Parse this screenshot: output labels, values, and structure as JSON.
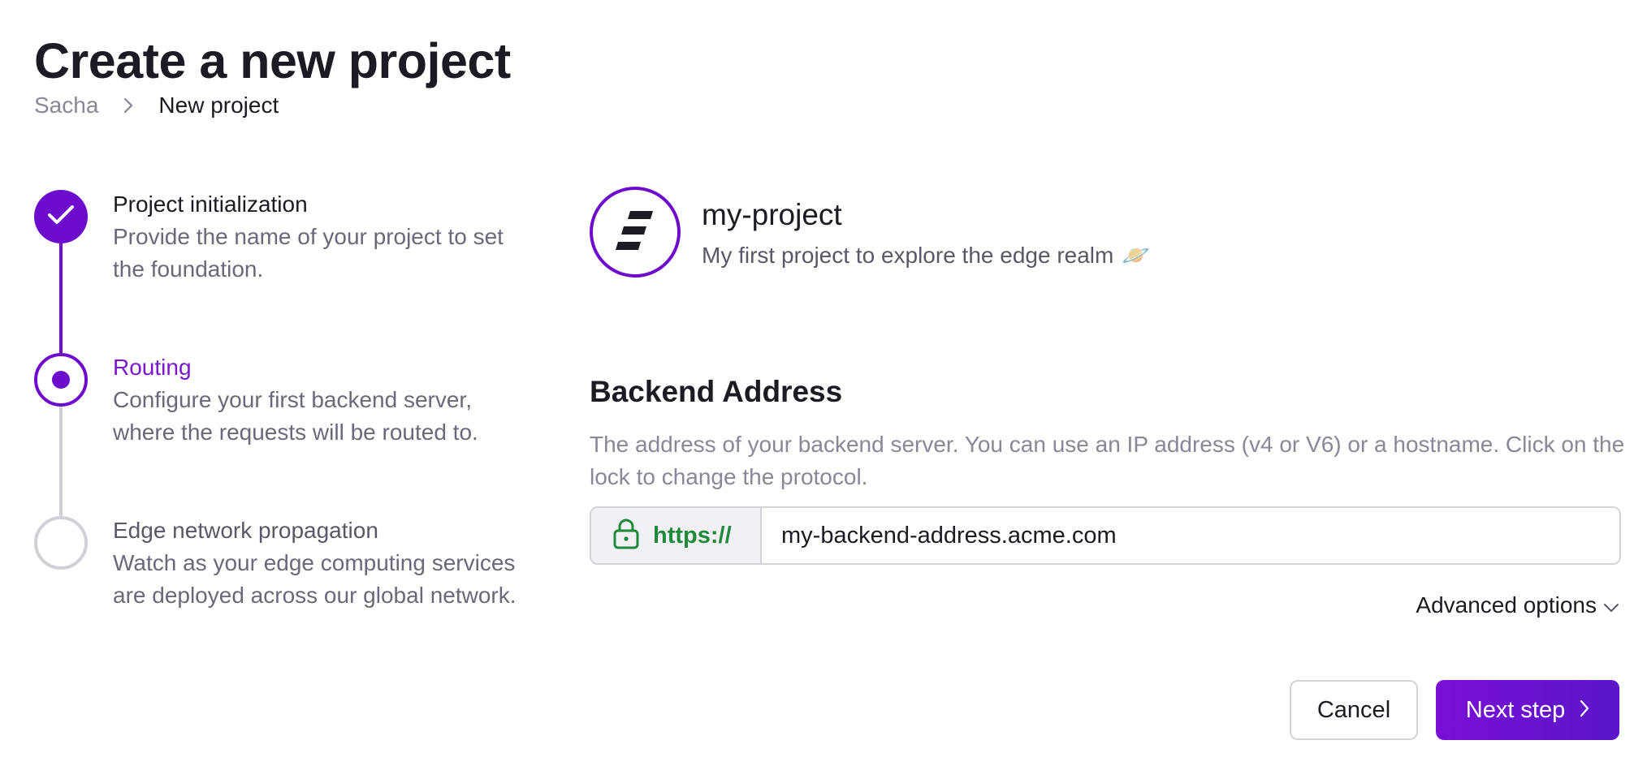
{
  "header": {
    "title": "Create a new project",
    "breadcrumb": {
      "root": "Sacha",
      "current": "New project"
    }
  },
  "steps": [
    {
      "title": "Project initialization",
      "description": "Provide the name of your project to set the foundation.",
      "status": "complete"
    },
    {
      "title": "Routing",
      "description": "Configure your first backend server, where the requests will be routed to.",
      "status": "current"
    },
    {
      "title": "Edge network propagation",
      "description": "Watch as your edge computing services are deployed across our global network.",
      "status": "pending"
    }
  ],
  "project": {
    "name": "my-project",
    "description": "My first project to explore the edge realm",
    "emoji": "🪐"
  },
  "backend": {
    "title": "Backend Address",
    "description": "The address of your backend server. You can use an IP address (v4 or V6) or a hostname. Click on the lock to change the protocol.",
    "protocol": "https://",
    "address_value": "my-backend-address.acme.com"
  },
  "advanced_label": "Advanced options",
  "actions": {
    "cancel_label": "Cancel",
    "next_label": "Next step"
  },
  "colors": {
    "accent": "#6d0ccc",
    "success": "#1f8a3a",
    "muted": "#8a8797"
  },
  "icons": {
    "breadcrumb_separator": "chevron-right-icon",
    "step_complete": "check-icon",
    "protocol": "lock-icon",
    "advanced": "chevron-down-icon",
    "next": "chevron-right-icon",
    "project_logo": "logo-icon"
  }
}
